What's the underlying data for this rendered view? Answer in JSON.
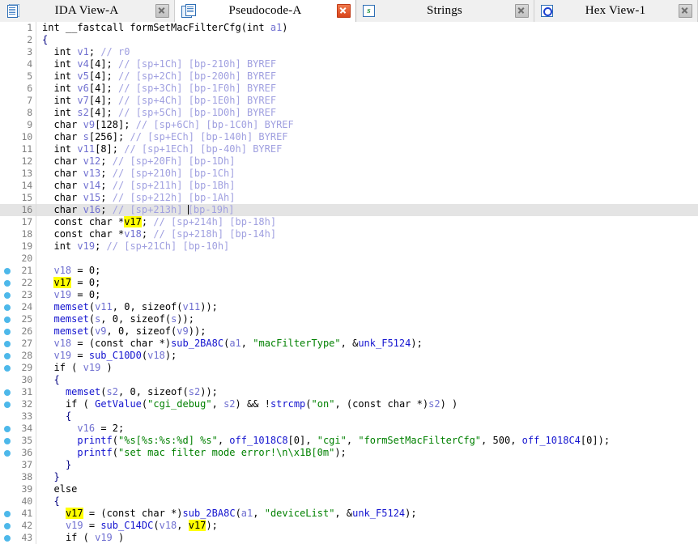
{
  "window": {
    "title": "IDA - Pseudocode-A"
  },
  "tabs": [
    {
      "label": "IDA View-A",
      "icon": "ida-view-icon",
      "active": false,
      "close_label": "x",
      "close_style": "gray"
    },
    {
      "label": "Pseudocode-A",
      "icon": "pseudocode-icon",
      "active": true,
      "close_label": "x",
      "close_style": "red"
    },
    {
      "label": "Strings",
      "icon": "strings-icon",
      "active": false,
      "close_label": "x",
      "close_style": "gray"
    },
    {
      "label": "Hex View-1",
      "icon": "hex-view-icon",
      "active": false,
      "close_label": "x",
      "close_style": "gray"
    }
  ],
  "editor": {
    "highlighted_identifier": "v17",
    "current_line": 16,
    "colors": {
      "highlight_token": "#ffff00",
      "current_line_bg": "#e4e4e4",
      "breakpoint_dot": "#4db8ea",
      "comment": "#a0a0e0",
      "string": "#008000",
      "function": "#1414cf",
      "variable": "#6f6fd0",
      "brace": "#000080",
      "line_number": "#808080"
    },
    "lines": [
      {
        "n": 1,
        "bp": false,
        "text": "int __fastcall formSetMacFilterCfg(int a1)"
      },
      {
        "n": 2,
        "bp": false,
        "text": "{"
      },
      {
        "n": 3,
        "bp": false,
        "text": "  int v1; // r0"
      },
      {
        "n": 4,
        "bp": false,
        "text": "  int v4[4]; // [sp+1Ch] [bp-210h] BYREF"
      },
      {
        "n": 5,
        "bp": false,
        "text": "  int v5[4]; // [sp+2Ch] [bp-200h] BYREF"
      },
      {
        "n": 6,
        "bp": false,
        "text": "  int v6[4]; // [sp+3Ch] [bp-1F0h] BYREF"
      },
      {
        "n": 7,
        "bp": false,
        "text": "  int v7[4]; // [sp+4Ch] [bp-1E0h] BYREF"
      },
      {
        "n": 8,
        "bp": false,
        "text": "  int s2[4]; // [sp+5Ch] [bp-1D0h] BYREF"
      },
      {
        "n": 9,
        "bp": false,
        "text": "  char v9[128]; // [sp+6Ch] [bp-1C0h] BYREF"
      },
      {
        "n": 10,
        "bp": false,
        "text": "  char s[256]; // [sp+ECh] [bp-140h] BYREF"
      },
      {
        "n": 11,
        "bp": false,
        "text": "  int v11[8]; // [sp+1ECh] [bp-40h] BYREF"
      },
      {
        "n": 12,
        "bp": false,
        "text": "  char v12; // [sp+20Fh] [bp-1Dh]"
      },
      {
        "n": 13,
        "bp": false,
        "text": "  char v13; // [sp+210h] [bp-1Ch]"
      },
      {
        "n": 14,
        "bp": false,
        "text": "  char v14; // [sp+211h] [bp-1Bh]"
      },
      {
        "n": 15,
        "bp": false,
        "text": "  char v15; // [sp+212h] [bp-1Ah]"
      },
      {
        "n": 16,
        "bp": false,
        "text": "  char v16; // [sp+213h] [bp-19h]"
      },
      {
        "n": 17,
        "bp": false,
        "text": "  const char *v17; // [sp+214h] [bp-18h]"
      },
      {
        "n": 18,
        "bp": false,
        "text": "  const char *v18; // [sp+218h] [bp-14h]"
      },
      {
        "n": 19,
        "bp": false,
        "text": "  int v19; // [sp+21Ch] [bp-10h]"
      },
      {
        "n": 20,
        "bp": false,
        "text": ""
      },
      {
        "n": 21,
        "bp": true,
        "text": "  v18 = 0;"
      },
      {
        "n": 22,
        "bp": true,
        "text": "  v17 = 0;"
      },
      {
        "n": 23,
        "bp": true,
        "text": "  v19 = 0;"
      },
      {
        "n": 24,
        "bp": true,
        "text": "  memset(v11, 0, sizeof(v11));"
      },
      {
        "n": 25,
        "bp": true,
        "text": "  memset(s, 0, sizeof(s));"
      },
      {
        "n": 26,
        "bp": true,
        "text": "  memset(v9, 0, sizeof(v9));"
      },
      {
        "n": 27,
        "bp": true,
        "text": "  v18 = (const char *)sub_2BA8C(a1, \"macFilterType\", &unk_F5124);"
      },
      {
        "n": 28,
        "bp": true,
        "text": "  v19 = sub_C10D0(v18);"
      },
      {
        "n": 29,
        "bp": true,
        "text": "  if ( v19 )"
      },
      {
        "n": 30,
        "bp": false,
        "text": "  {"
      },
      {
        "n": 31,
        "bp": true,
        "text": "    memset(s2, 0, sizeof(s2));"
      },
      {
        "n": 32,
        "bp": true,
        "text": "    if ( GetValue(\"cgi_debug\", s2) && !strcmp(\"on\", (const char *)s2) )"
      },
      {
        "n": 33,
        "bp": false,
        "text": "    {"
      },
      {
        "n": 34,
        "bp": true,
        "text": "      v16 = 2;"
      },
      {
        "n": 35,
        "bp": true,
        "text": "      printf(\"%s[%s:%s:%d] %s\", off_1018C8[0], \"cgi\", \"formSetMacFilterCfg\", 500, off_1018C4[0]);"
      },
      {
        "n": 36,
        "bp": true,
        "text": "      printf(\"set mac filter mode error!\\n\\x1B[0m\");"
      },
      {
        "n": 37,
        "bp": false,
        "text": "    }"
      },
      {
        "n": 38,
        "bp": false,
        "text": "  }"
      },
      {
        "n": 39,
        "bp": false,
        "text": "  else"
      },
      {
        "n": 40,
        "bp": false,
        "text": "  {"
      },
      {
        "n": 41,
        "bp": true,
        "text": "    v17 = (const char *)sub_2BA8C(a1, \"deviceList\", &unk_F5124);"
      },
      {
        "n": 42,
        "bp": true,
        "text": "    v19 = sub_C14DC(v18, v17);"
      },
      {
        "n": 43,
        "bp": true,
        "text": "    if ( v19 )"
      }
    ]
  }
}
